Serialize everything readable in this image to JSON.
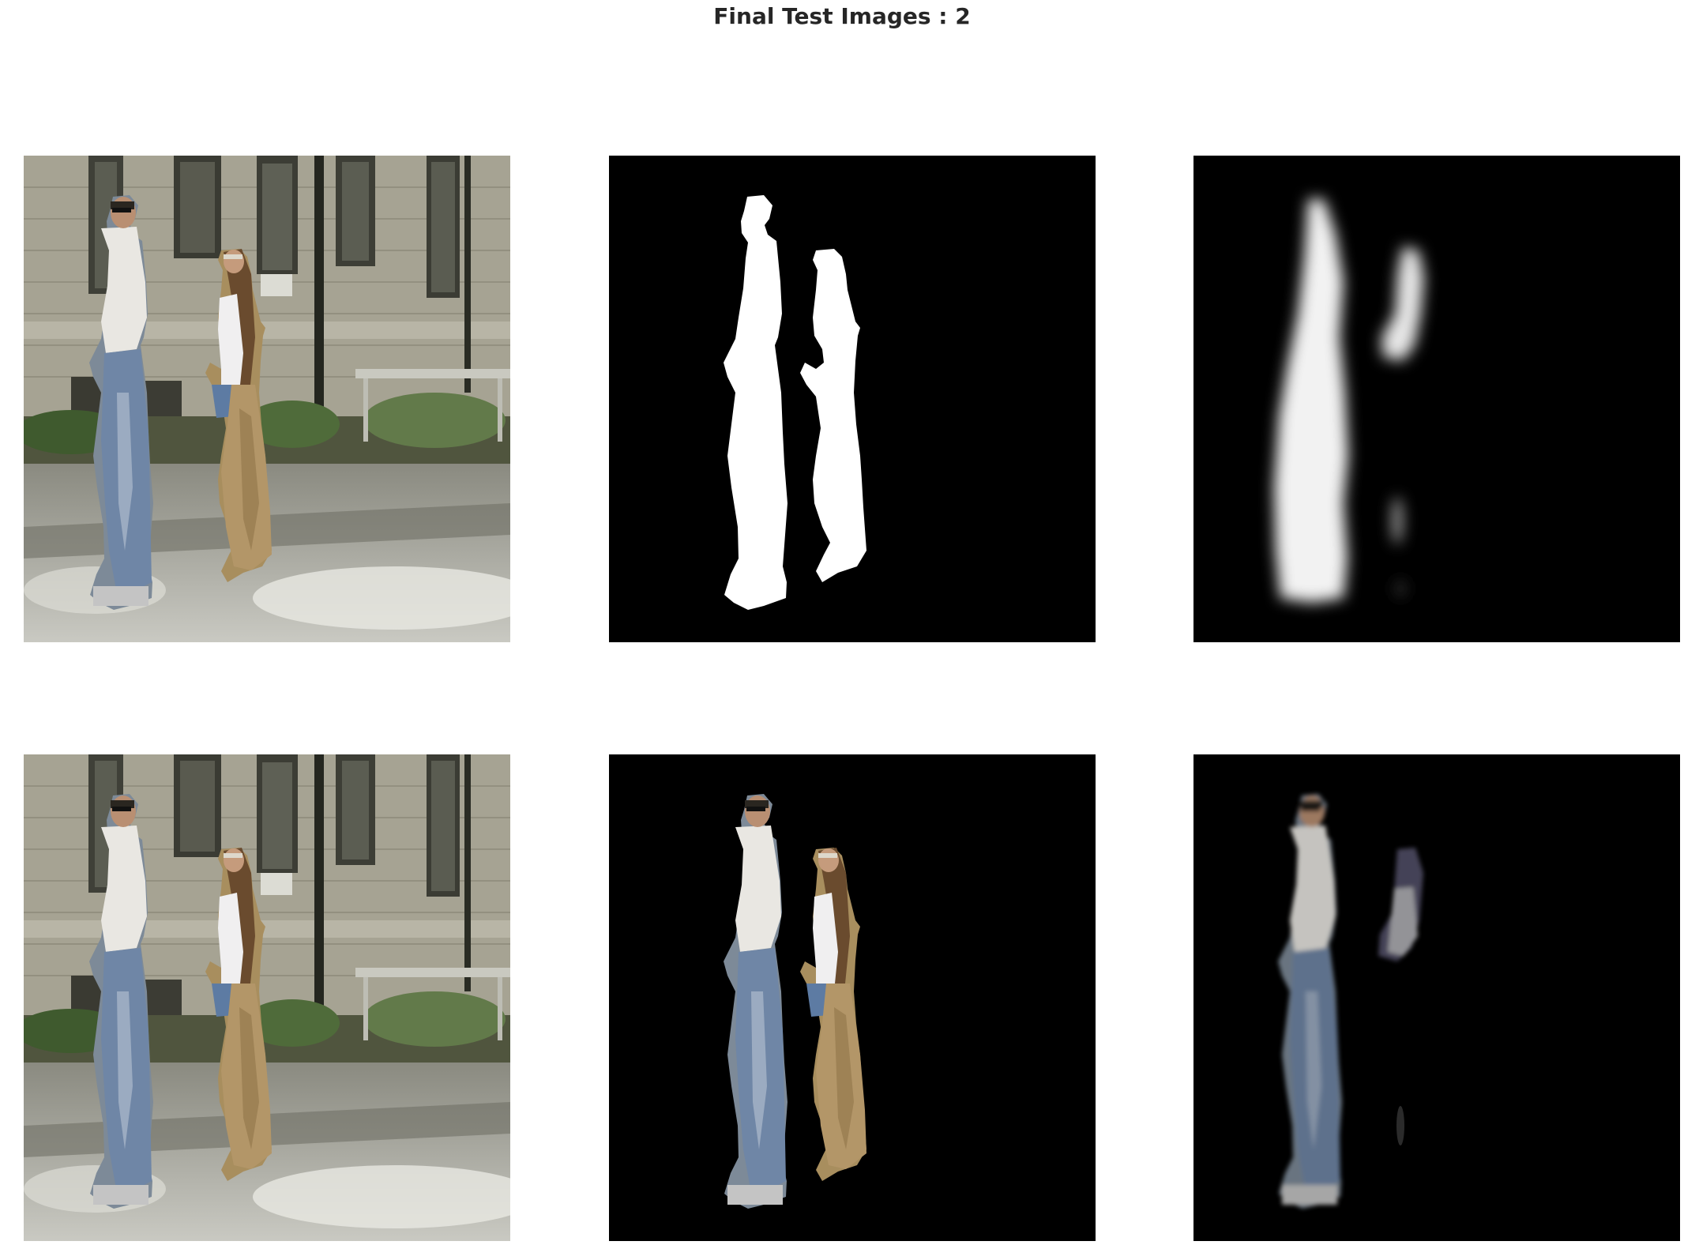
{
  "figure": {
    "title": "Final Test Images : 2"
  },
  "panels": [
    {
      "row": 0,
      "col": 0,
      "content": "original-photo",
      "icon": "photo-icon"
    },
    {
      "row": 0,
      "col": 1,
      "content": "ground-truth-mask",
      "icon": "mask-icon"
    },
    {
      "row": 0,
      "col": 2,
      "content": "predicted-mask",
      "icon": "mask-icon"
    },
    {
      "row": 1,
      "col": 0,
      "content": "original-photo",
      "icon": "photo-icon"
    },
    {
      "row": 1,
      "col": 1,
      "content": "ground-truth-masked-photo",
      "icon": "photo-icon"
    },
    {
      "row": 1,
      "col": 2,
      "content": "predicted-masked-photo",
      "icon": "photo-icon"
    }
  ],
  "colors": {
    "background": "#ffffff",
    "mask_background": "#000000",
    "mask_foreground": "#ffffff",
    "title_text": "#262626"
  }
}
